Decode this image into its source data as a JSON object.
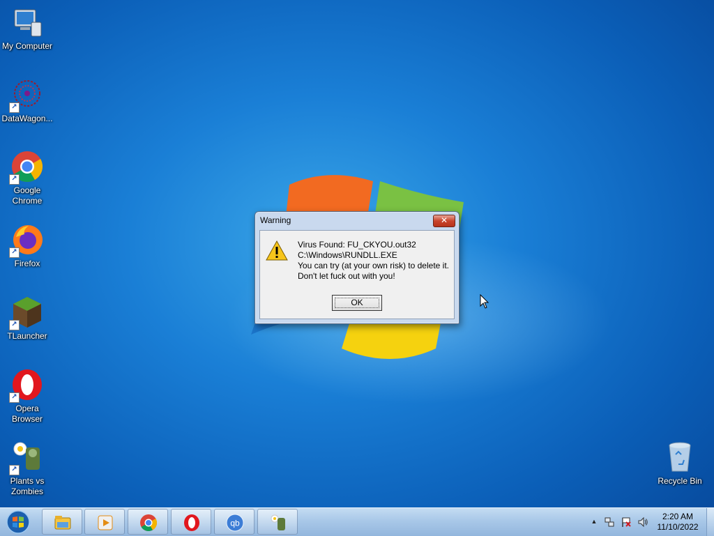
{
  "desktop": {
    "icons": [
      {
        "label": "My Computer"
      },
      {
        "label": "DataWagon..."
      },
      {
        "label": "Google Chrome"
      },
      {
        "label": "Firefox"
      },
      {
        "label": "TLauncher"
      },
      {
        "label": "Opera Browser"
      },
      {
        "label": "Plants vs Zombies"
      },
      {
        "label": "Recycle Bin"
      }
    ]
  },
  "dialog": {
    "title": "Warning",
    "close_glyph": "✕",
    "icon": "warning-icon",
    "lines": [
      "Virus Found: FU_CKYOU.out32",
      "C:\\Windows\\RUNDLL.EXE",
      "You can try (at your own risk) to delete it.",
      "Don't let fuck out with you!"
    ],
    "ok_label": "OK"
  },
  "taskbar": {
    "pinned": [
      "file-explorer-icon",
      "media-player-icon",
      "chrome-icon",
      "opera-icon",
      "qbittorrent-icon",
      "plants-vs-zombies-icon"
    ],
    "qb_text": "qb",
    "tray": {
      "up_arrow": "▲",
      "time": "2:20 AM",
      "date": "11/10/2022"
    }
  },
  "colors": {
    "desktop_blue": "#1a7fd6",
    "close_red": "#c8442c",
    "taskbar": "#a9c8e8"
  }
}
